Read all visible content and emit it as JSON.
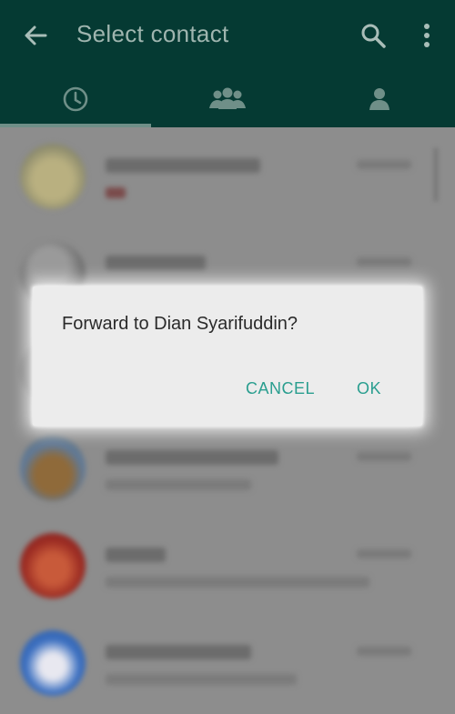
{
  "app_bar": {
    "title": "Select contact",
    "icons": {
      "back": "arrow-left-icon",
      "search": "search-icon",
      "more": "more-vertical-icon"
    },
    "background": "#053a33",
    "tabs": [
      {
        "name": "recent",
        "icon": "clock-icon",
        "active": true
      },
      {
        "name": "groups",
        "icon": "group-icon",
        "active": false
      },
      {
        "name": "contacts",
        "icon": "person-icon",
        "active": false
      }
    ]
  },
  "dialog": {
    "message": "Forward to Dian Syarifuddin?",
    "cancel_label": "CANCEL",
    "ok_label": "OK",
    "accent": "#2a9e8f"
  }
}
